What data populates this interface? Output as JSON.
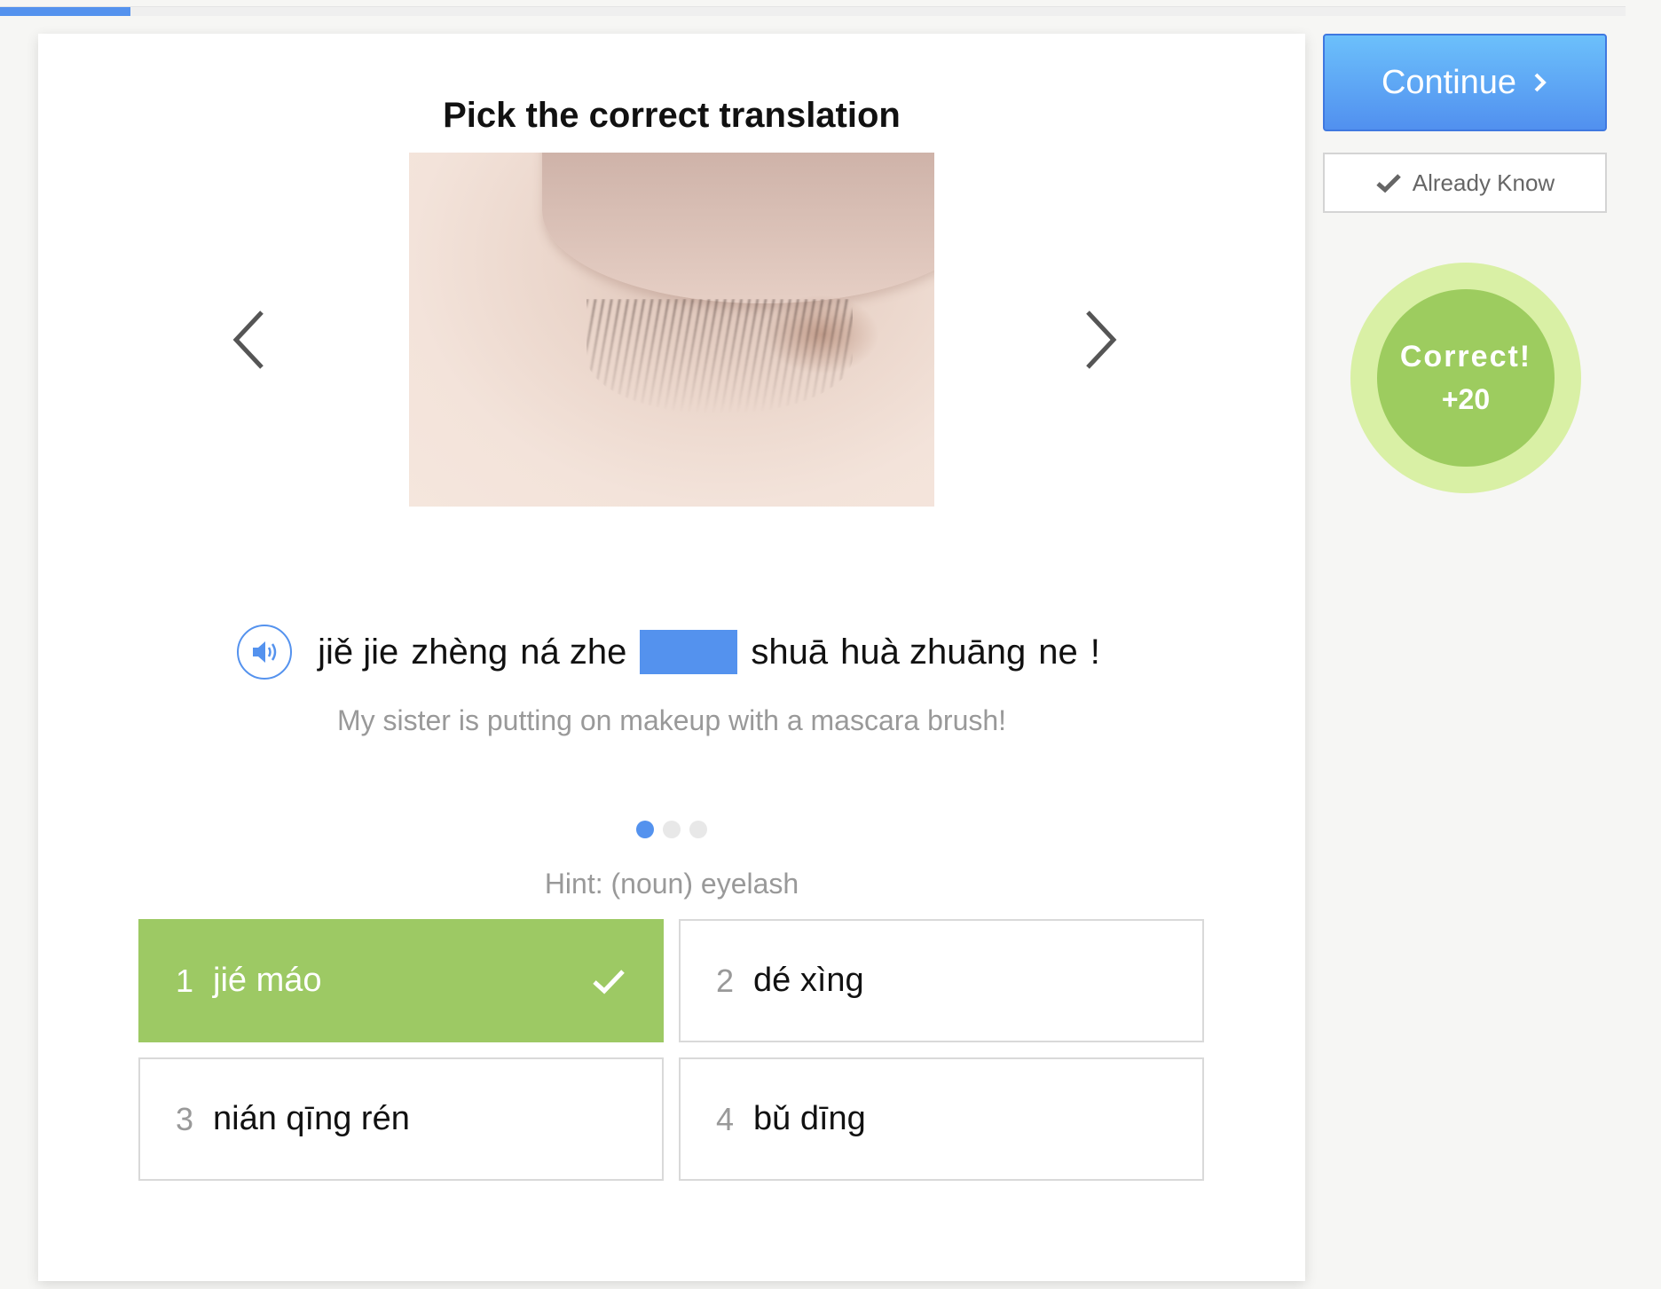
{
  "progress": {
    "percent": 8
  },
  "exercise": {
    "title": "Pick the correct translation",
    "image": {
      "alt": "close-up of a closed eye with eyelashes"
    },
    "sentence": {
      "words_before": [
        "jiě jie",
        "zhèng",
        "ná zhe"
      ],
      "words_after": [
        "shuā",
        "huà zhuāng",
        "ne",
        "!"
      ]
    },
    "translation": "My sister is putting on makeup with a mascara brush!",
    "carousel": {
      "count": 3,
      "active_index": 0
    },
    "hint": "Hint: (noun) eyelash",
    "options": [
      {
        "number": "1",
        "text": "jié máo",
        "state": "correct"
      },
      {
        "number": "2",
        "text": "dé xìng",
        "state": "default"
      },
      {
        "number": "3",
        "text": "nián qīng rén",
        "state": "default"
      },
      {
        "number": "4",
        "text": "bǔ dīng",
        "state": "default"
      }
    ]
  },
  "sidebar": {
    "continue_label": "Continue",
    "already_know_label": "Already Know",
    "feedback": {
      "line1": "Correct!",
      "line2": "+20"
    }
  },
  "colors": {
    "accent": "#5492ee",
    "correct": "#9dc964",
    "badge_outer": "#d9f0a5"
  }
}
